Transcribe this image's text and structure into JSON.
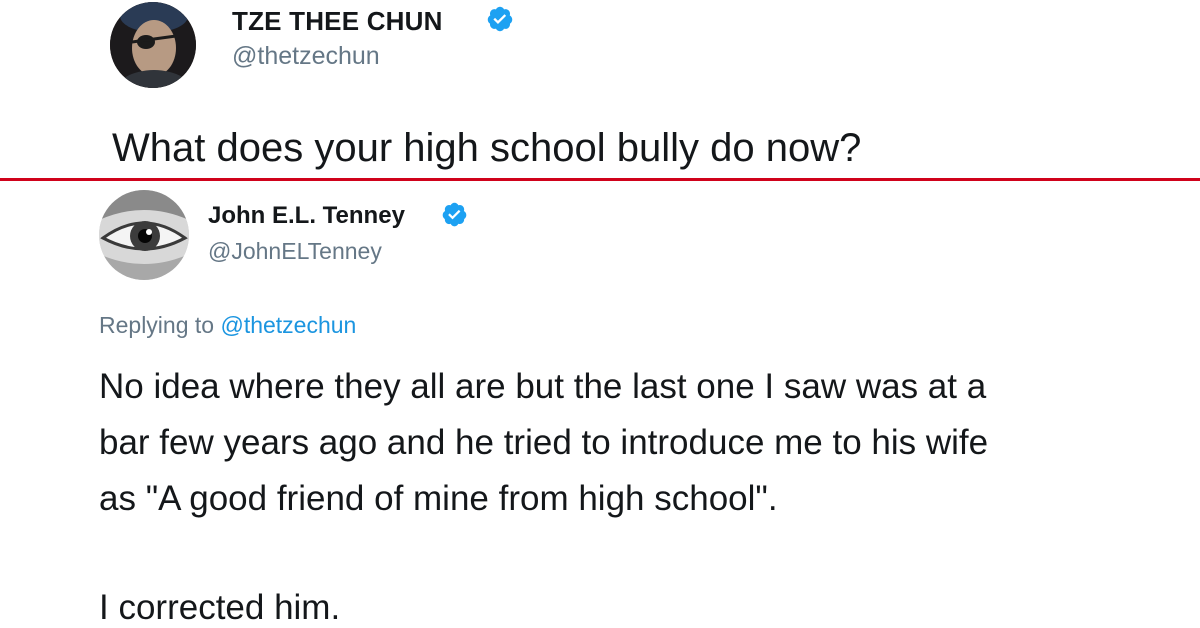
{
  "tweet": {
    "author_name": "TZE THEE CHUN",
    "author_handle": "@thetzechun",
    "text": "What does your high school bully do now?"
  },
  "reply": {
    "author_name": "John E.L. Tenney",
    "author_handle": "@JohnELTenney",
    "replying_prefix": "Replying to ",
    "replying_handle": "@thetzechun",
    "lines": [
      "No idea where they all are but the last one I saw was at a",
      "bar few years ago and he tried to introduce me to his wife",
      "as \"A good friend of mine from high school\".",
      "I corrected him."
    ]
  },
  "icons": {
    "verified": "verified-badge-icon"
  },
  "colors": {
    "verified": "#1da1f2",
    "handle": "#657786",
    "link": "#1b95e0",
    "divider": "#d0021b",
    "text": "#14171a"
  }
}
